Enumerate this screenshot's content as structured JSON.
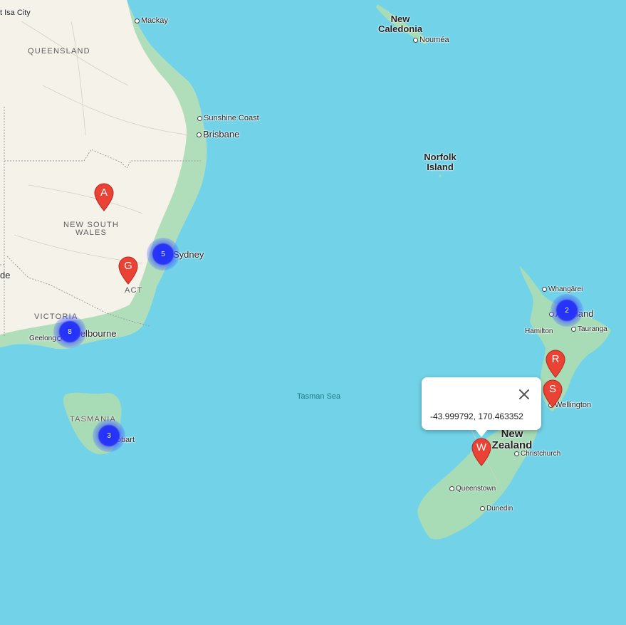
{
  "map": {
    "colors": {
      "water": "#72d3e8",
      "land": "#f5f2ea",
      "green": "#a8dcb6",
      "marker": "#ea4335",
      "cluster": "#2a36f4"
    },
    "cities": {
      "isa": "t Isa City",
      "mackay": "Mackay",
      "sunshine": "Sunshine Coast",
      "brisbane": "Brisbane",
      "sydney": "Sydney",
      "melbourne": "Melbourne",
      "geelong": "Geelong",
      "hobart": "Hobart",
      "noumea": "Nouméa",
      "whangarei": "Whangārei",
      "auckland": "Auckland",
      "hamilton": "Hamilton",
      "tauranga": "Tauranga",
      "wellington": "Wellington",
      "christchurch": "Christchurch",
      "queenstown": "Queenstown",
      "dunedin": "Dunedin",
      "adelaide_fragment": "de"
    },
    "regions": {
      "queensland": "QUEENSLAND",
      "nsw_1": "NEW SOUTH",
      "nsw_2": "WALES",
      "act": "ACT",
      "victoria": "VICTORIA",
      "tasmania": "TASMANIA"
    },
    "countries": {
      "nc_1": "New",
      "nc_2": "Caledonia",
      "norfolk_1": "Norfolk",
      "norfolk_2": "Island",
      "nz_1": "New",
      "nz_2": "Zealand"
    },
    "sea": "Tasman Sea"
  },
  "clusters": [
    {
      "count": "5",
      "near": "Sydney"
    },
    {
      "count": "8",
      "near": "Melbourne"
    },
    {
      "count": "3",
      "near": "Hobart"
    },
    {
      "count": "2",
      "near": "Auckland"
    }
  ],
  "markers": [
    {
      "label": "A"
    },
    {
      "label": "G"
    },
    {
      "label": "R"
    },
    {
      "label": "S"
    },
    {
      "label": "W"
    }
  ],
  "popup": {
    "coords": "-43.999792, 170.463352",
    "close_icon": "close-icon"
  }
}
